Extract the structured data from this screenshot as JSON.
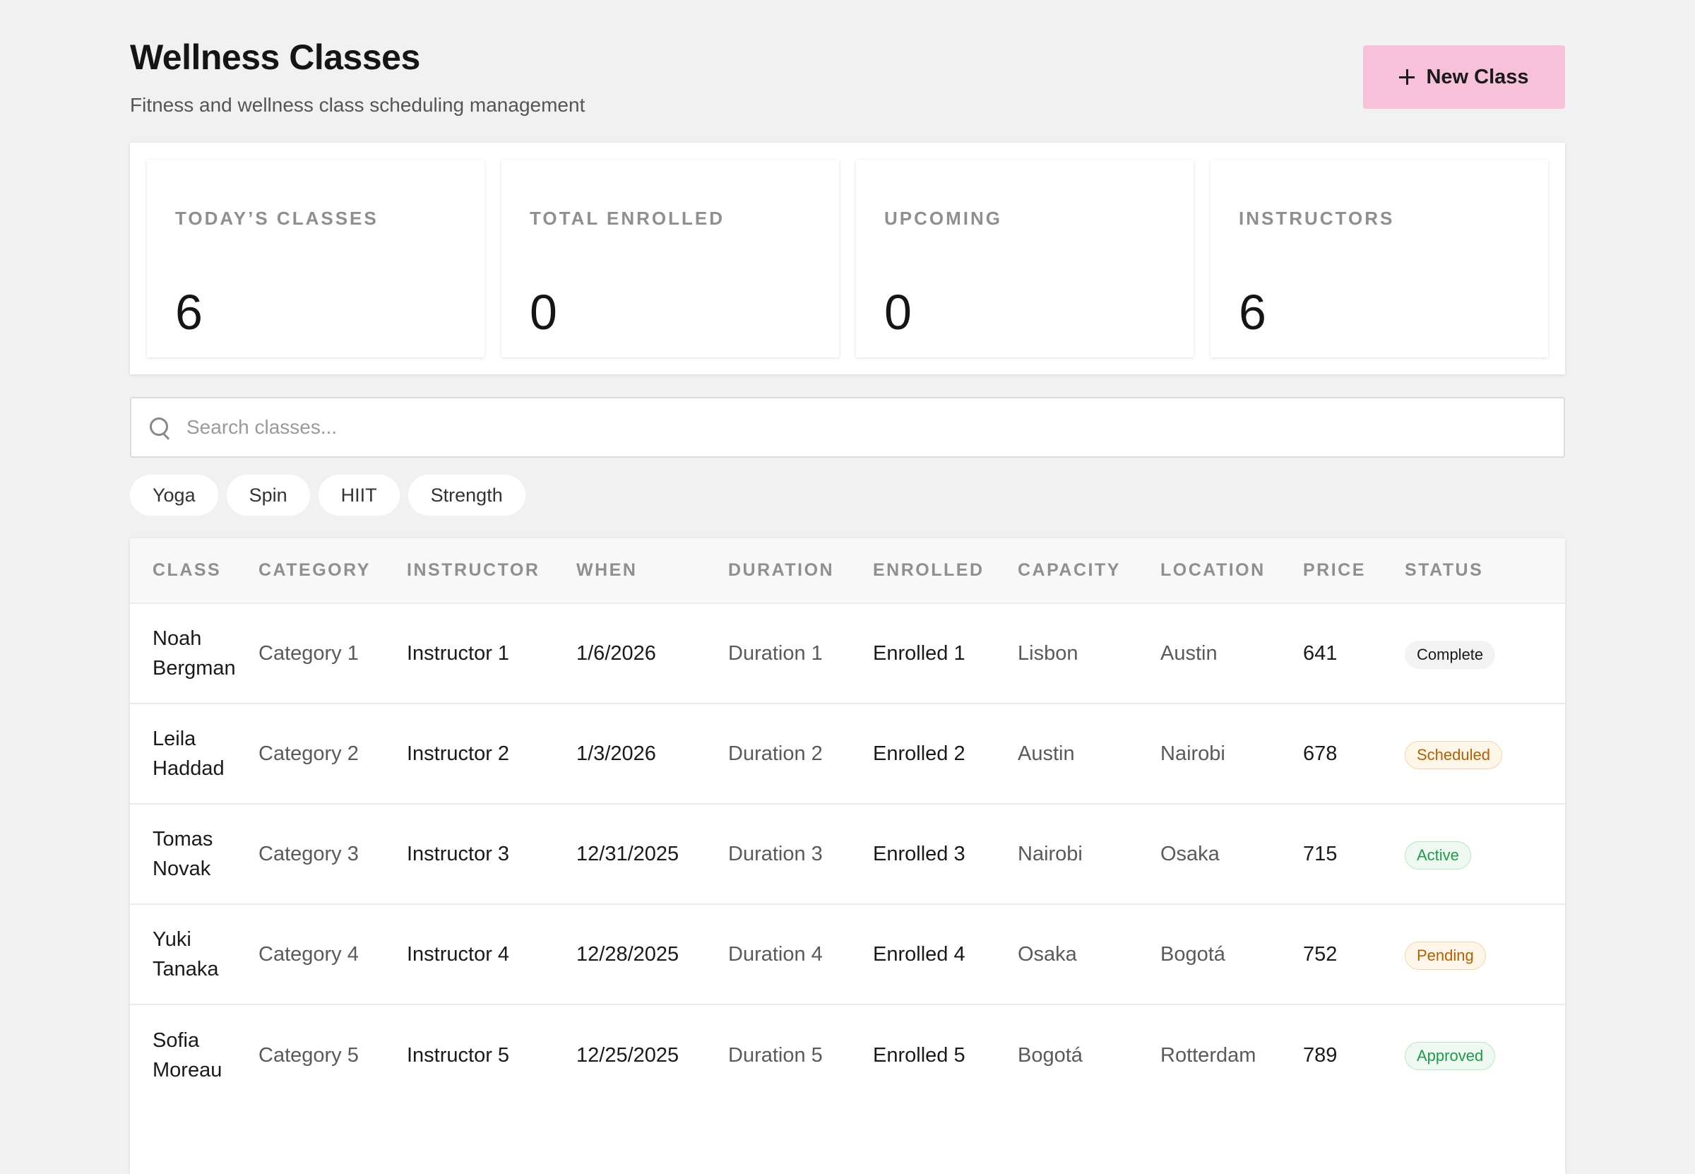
{
  "header": {
    "title": "Wellness Classes",
    "subtitle": "Fitness and wellness class scheduling management",
    "new_button_label": "New Class"
  },
  "stats": [
    {
      "label": "TODAY’S CLASSES",
      "value": "6"
    },
    {
      "label": "TOTAL ENROLLED",
      "value": "0"
    },
    {
      "label": "UPCOMING",
      "value": "0"
    },
    {
      "label": "INSTRUCTORS",
      "value": "6"
    }
  ],
  "search": {
    "placeholder": "Search classes...",
    "value": ""
  },
  "filters": [
    "Yoga",
    "Spin",
    "HIIT",
    "Strength"
  ],
  "table": {
    "columns": [
      "CLASS",
      "CATEGORY",
      "INSTRUCTOR",
      "WHEN",
      "DURATION",
      "ENROLLED",
      "CAPACITY",
      "LOCATION",
      "PRICE",
      "STATUS"
    ],
    "rows": [
      {
        "class": "Noah Bergman",
        "category": "Category 1",
        "instructor": "Instructor 1",
        "when": "1/6/2026",
        "duration": "Duration 1",
        "enrolled": "Enrolled 1",
        "capacity": "Lisbon",
        "location": "Austin",
        "price": "641",
        "status": "Complete"
      },
      {
        "class": "Leila Haddad",
        "category": "Category 2",
        "instructor": "Instructor 2",
        "when": "1/3/2026",
        "duration": "Duration 2",
        "enrolled": "Enrolled 2",
        "capacity": "Austin",
        "location": "Nairobi",
        "price": "678",
        "status": "Scheduled"
      },
      {
        "class": "Tomas Novak",
        "category": "Category 3",
        "instructor": "Instructor 3",
        "when": "12/31/2025",
        "duration": "Duration 3",
        "enrolled": "Enrolled 3",
        "capacity": "Nairobi",
        "location": "Osaka",
        "price": "715",
        "status": "Active"
      },
      {
        "class": "Yuki Tanaka",
        "category": "Category 4",
        "instructor": "Instructor 4",
        "when": "12/28/2025",
        "duration": "Duration 4",
        "enrolled": "Enrolled 4",
        "capacity": "Osaka",
        "location": "Bogotá",
        "price": "752",
        "status": "Pending"
      },
      {
        "class": "Sofia Moreau",
        "category": "Category 5",
        "instructor": "Instructor 5",
        "when": "12/25/2025",
        "duration": "Duration 5",
        "enrolled": "Enrolled 5",
        "capacity": "Bogotá",
        "location": "Rotterdam",
        "price": "789",
        "status": "Approved"
      }
    ]
  },
  "colors": {
    "accent": "#f6c1d9",
    "background": "#f1f1f1",
    "status_complete": "#1a1a1a",
    "status_scheduled": "#b36100",
    "status_active": "#1f9a4a",
    "status_pending": "#b36100",
    "status_approved": "#1f9a4a"
  },
  "icons": {
    "new_button": "plus-icon",
    "search": "search-icon"
  }
}
